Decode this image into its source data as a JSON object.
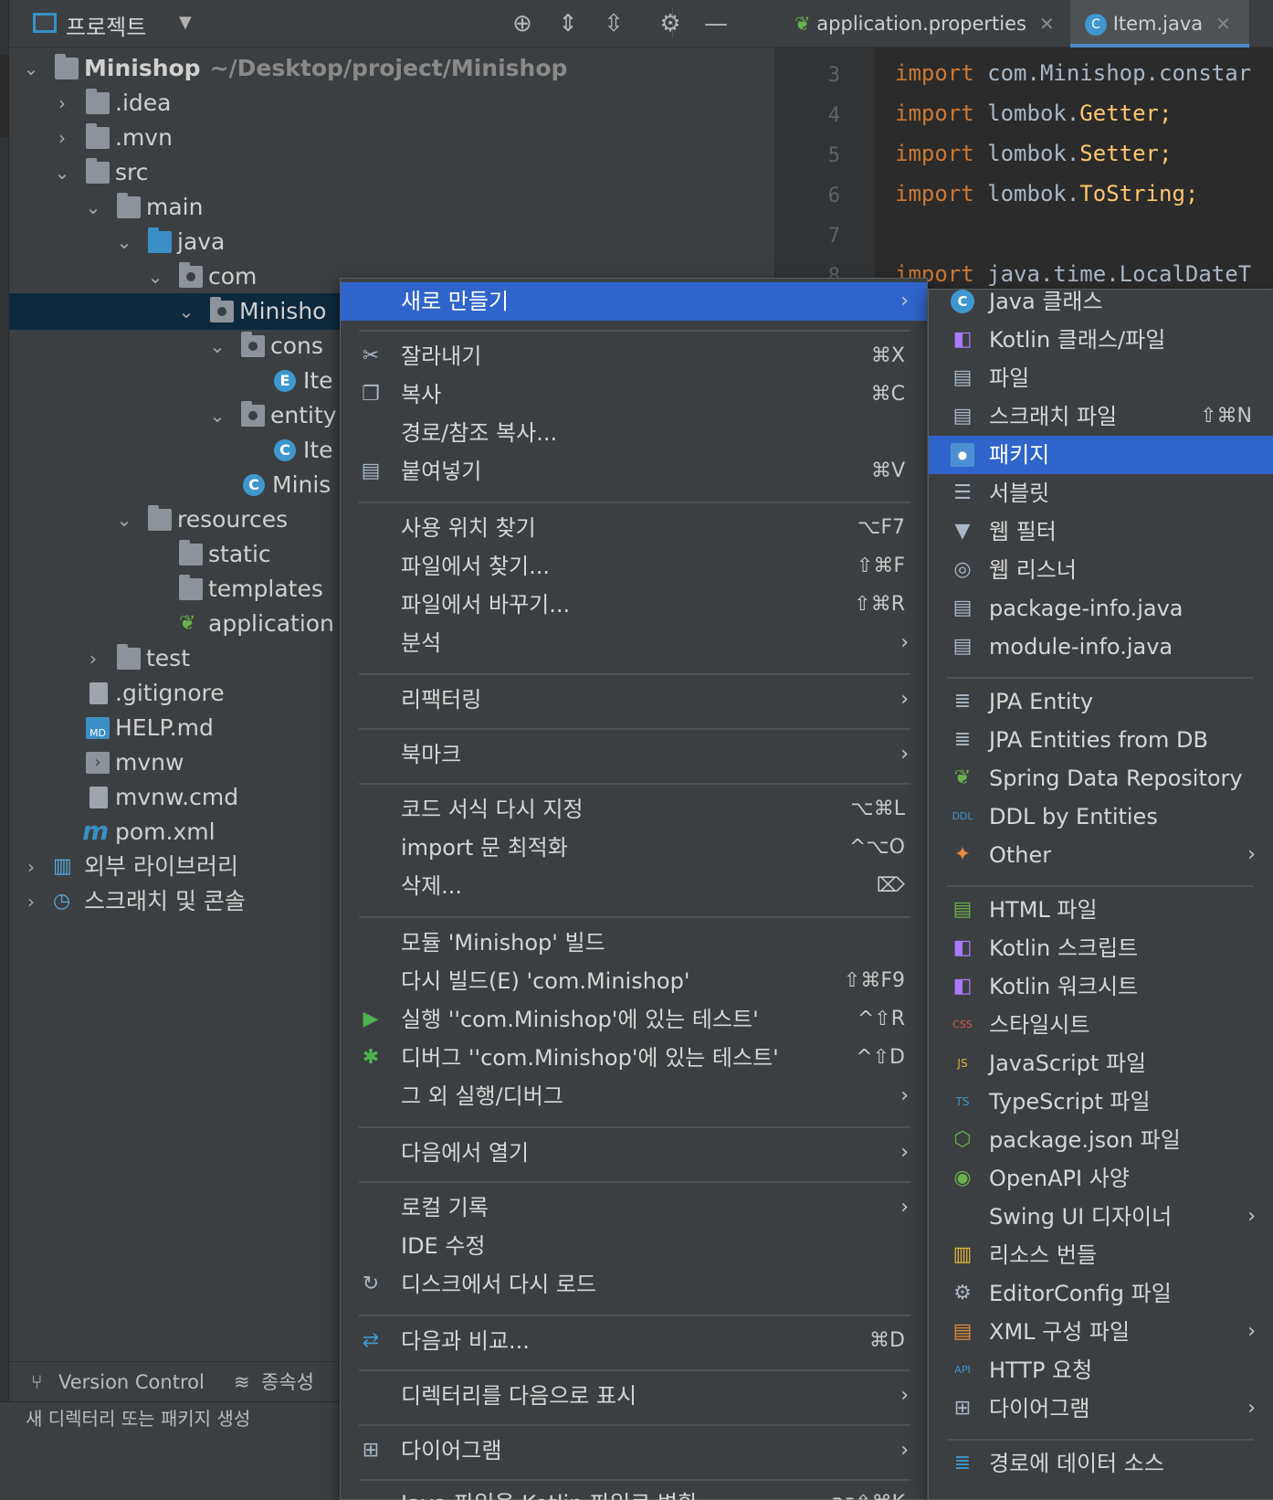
{
  "project_panel": {
    "title": "프로젝트",
    "tree": [
      {
        "label": "Minishop",
        "hint": "~/Desktop/project/Minishop"
      },
      {
        "label": ".idea"
      },
      {
        "label": ".mvn"
      },
      {
        "label": "src"
      },
      {
        "label": "main"
      },
      {
        "label": "java"
      },
      {
        "label": "com"
      },
      {
        "label": "Minisho"
      },
      {
        "label": "cons"
      },
      {
        "label": "Ite"
      },
      {
        "label": "entity"
      },
      {
        "label": "Ite"
      },
      {
        "label": "Minis"
      },
      {
        "label": "resources"
      },
      {
        "label": "static"
      },
      {
        "label": "templates"
      },
      {
        "label": "application"
      },
      {
        "label": "test"
      },
      {
        "label": ".gitignore"
      },
      {
        "label": "HELP.md"
      },
      {
        "label": "mvnw"
      },
      {
        "label": "mvnw.cmd"
      },
      {
        "label": "pom.xml"
      },
      {
        "label": "외부 라이브러리"
      },
      {
        "label": "스크래치 및 콘솔"
      }
    ],
    "bottom_tabs": [
      "Version Control",
      "종속성"
    ],
    "status_text": "새 디렉터리 또는 패키지 생성"
  },
  "editor": {
    "tabs": [
      {
        "label": "application.properties",
        "active": false
      },
      {
        "label": "Item.java",
        "active": true
      }
    ],
    "lines": [
      {
        "num": "3",
        "kw": "import",
        "rest": " com.Minishop.constar",
        "rest_class": "pk"
      },
      {
        "num": "4",
        "kw": "import",
        "rest": " lombok.",
        "tail": "Getter;"
      },
      {
        "num": "5",
        "kw": "import",
        "rest": " lombok.",
        "tail": "Setter;"
      },
      {
        "num": "6",
        "kw": "import",
        "rest": " lombok.",
        "tail": "ToString;"
      },
      {
        "num": "7",
        "kw": "",
        "rest": ""
      },
      {
        "num": "8",
        "kw": "import",
        "rest": " java.time.LocalDateT"
      }
    ]
  },
  "context_menu": {
    "items": [
      {
        "label": "새로 만들기",
        "shortcut": "",
        "submenu": true,
        "highlight": true
      },
      {
        "label": "잘라내기",
        "shortcut": "⌘X"
      },
      {
        "label": "복사",
        "shortcut": "⌘C"
      },
      {
        "label": "경로/참조 복사...",
        "shortcut": ""
      },
      {
        "label": "붙여넣기",
        "shortcut": "⌘V"
      },
      {
        "label": "사용 위치 찾기",
        "shortcut": "⌥F7"
      },
      {
        "label": "파일에서 찾기...",
        "shortcut": "⇧⌘F"
      },
      {
        "label": "파일에서 바꾸기...",
        "shortcut": "⇧⌘R"
      },
      {
        "label": "분석",
        "submenu": true
      },
      {
        "label": "리팩터링",
        "submenu": true
      },
      {
        "label": "북마크",
        "submenu": true
      },
      {
        "label": "코드 서식 다시 지정",
        "shortcut": "⌥⌘L"
      },
      {
        "label": "import 문 최적화",
        "shortcut": "^⌥O"
      },
      {
        "label": "삭제...",
        "shortcut": "⌦"
      },
      {
        "label": "모듈 'Minishop' 빌드",
        "shortcut": ""
      },
      {
        "label": "다시 빌드(E) 'com.Minishop'",
        "shortcut": "⇧⌘F9"
      },
      {
        "label": "실행 ''com.Minishop'에 있는 테스트'",
        "shortcut": "^⇧R"
      },
      {
        "label": "디버그 ''com.Minishop'에 있는 테스트'",
        "shortcut": "^⇧D"
      },
      {
        "label": "그 외 실행/디버그",
        "submenu": true
      },
      {
        "label": "다음에서 열기",
        "submenu": true
      },
      {
        "label": "로컬 기록",
        "submenu": true
      },
      {
        "label": "IDE 수정",
        "shortcut": ""
      },
      {
        "label": "디스크에서 다시 로드",
        "shortcut": ""
      },
      {
        "label": "다음과 비교...",
        "shortcut": "⌘D"
      },
      {
        "label": "디렉터리를 다음으로 표시",
        "submenu": true
      },
      {
        "label": "다이어그램",
        "submenu": true
      },
      {
        "label": "Java 파일을 Kotlin 파일로 변환",
        "shortcut": "⌥⇧⌘K"
      }
    ]
  },
  "new_submenu": {
    "items": [
      {
        "label": "Java 클래스"
      },
      {
        "label": "Kotlin 클래스/파일"
      },
      {
        "label": "파일"
      },
      {
        "label": "스크래치 파일",
        "shortcut": "⇧⌘N"
      },
      {
        "label": "패키지",
        "highlight": true
      },
      {
        "label": "서블릿"
      },
      {
        "label": "웹 필터"
      },
      {
        "label": "웹 리스너"
      },
      {
        "label": "package-info.java"
      },
      {
        "label": "module-info.java"
      },
      {
        "label": "JPA Entity"
      },
      {
        "label": "JPA Entities from DB"
      },
      {
        "label": "Spring Data Repository"
      },
      {
        "label": "DDL by Entities"
      },
      {
        "label": "Other",
        "submenu": true
      },
      {
        "label": "HTML 파일"
      },
      {
        "label": "Kotlin 스크립트"
      },
      {
        "label": "Kotlin 워크시트"
      },
      {
        "label": "스타일시트"
      },
      {
        "label": "JavaScript 파일"
      },
      {
        "label": "TypeScript 파일"
      },
      {
        "label": "package.json 파일"
      },
      {
        "label": "OpenAPI 사양"
      },
      {
        "label": "Swing UI 디자이너",
        "submenu": true
      },
      {
        "label": "리소스 번들"
      },
      {
        "label": "EditorConfig 파일"
      },
      {
        "label": "XML 구성 파일",
        "submenu": true
      },
      {
        "label": "HTTP 요청"
      },
      {
        "label": "다이어그램",
        "submenu": true
      },
      {
        "label": "경로에 데이터 소스"
      }
    ]
  },
  "colors": {
    "menu_highlight": "#2f65ca",
    "tree_selection": "#0d293e",
    "keyword": "#cc7832",
    "class_icon": "#3f97cf"
  }
}
